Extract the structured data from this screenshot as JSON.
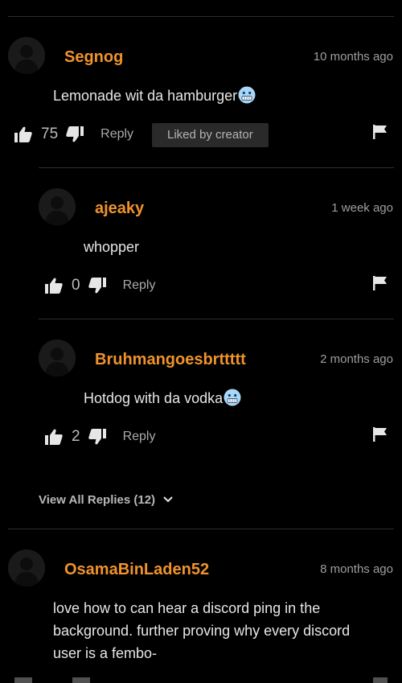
{
  "comments": [
    {
      "username": "Segnog",
      "timestamp": "10 months ago",
      "text": "Lemonade wit da hamburger",
      "emoji": "cold-face-emoji",
      "likes": "75",
      "reply_label": "Reply",
      "badge": "Liked by creator"
    }
  ],
  "replies": [
    {
      "username": "ajeaky",
      "timestamp": "1 week ago",
      "text": "whopper",
      "likes": "0",
      "reply_label": "Reply"
    },
    {
      "username": "Bruhmangoesbrttttt",
      "timestamp": "2 months ago",
      "text": "Hotdog with da vodka",
      "emoji": "cold-face-emoji",
      "likes": "2",
      "reply_label": "Reply"
    }
  ],
  "view_all_replies": "View All Replies (12)",
  "second_comment": {
    "username": "OsamaBinLaden52",
    "timestamp": "8 months ago",
    "text_lines": [
      "love how to can hear a discord ping in the",
      "background. further proving why every discord",
      "user is a fembo-"
    ]
  },
  "colors": {
    "username": "#f0932b",
    "background": "#000000",
    "badge_bg": "#2a2a2a"
  }
}
